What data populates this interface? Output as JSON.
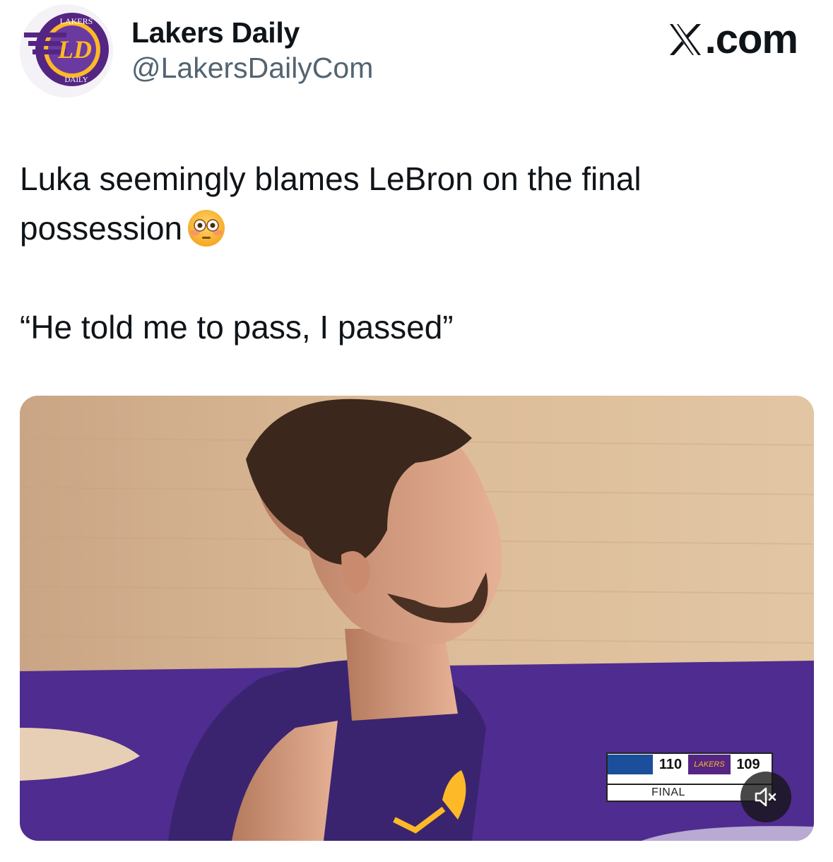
{
  "author": {
    "name": "Lakers Daily",
    "handle": "@LakersDailyCom",
    "avatar_text_top": "LAKERS",
    "avatar_text_mid": "LD",
    "avatar_text_bottom": "DAILY"
  },
  "brand": {
    "label": ".com",
    "icon": "x-logo-icon"
  },
  "tweet": {
    "line1": "Luka seemingly blames LeBron on the final possession",
    "emoji": "flushed-face-icon",
    "line2": "“He told me to pass, I passed”"
  },
  "media": {
    "scorebug": {
      "home_score": "110",
      "away_score": "109",
      "status": "FINAL",
      "away_logo_text": "LAKERS"
    },
    "mute_icon": "volume-muted-icon"
  },
  "colors": {
    "text": "#0f1419",
    "secondary_text": "#536471",
    "lakers_purple": "#552583",
    "lakers_gold": "#fdb927"
  }
}
